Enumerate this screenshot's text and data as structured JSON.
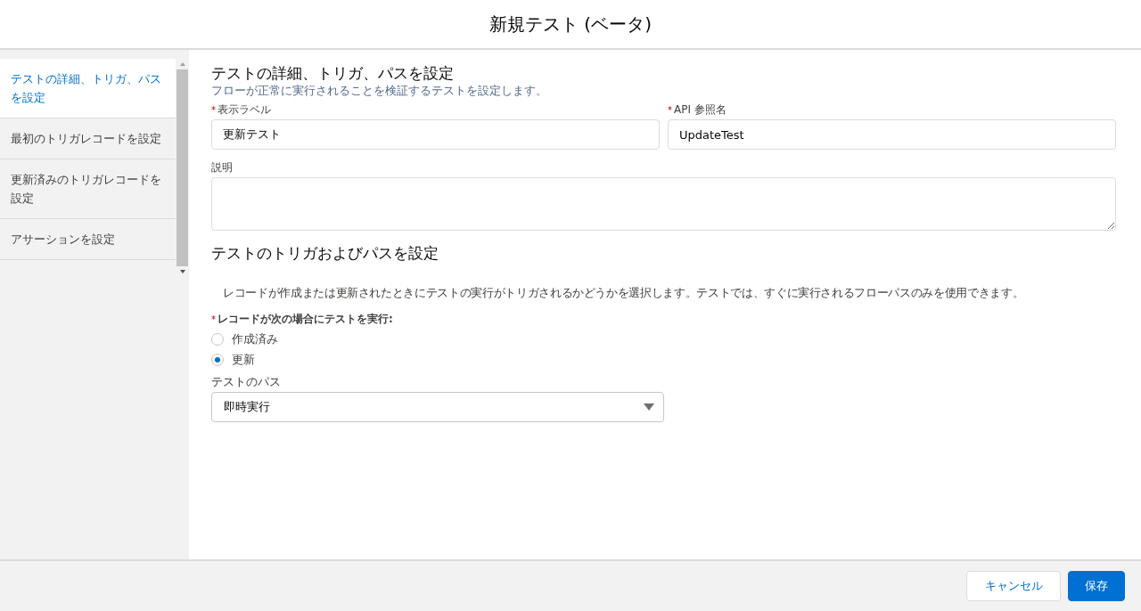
{
  "modal": {
    "title": "新規テスト (ベータ)"
  },
  "steps": [
    {
      "label": "テストの詳細、トリガ、パスを設定",
      "selected": true
    },
    {
      "label": "最初のトリガレコードを設定",
      "selected": false
    },
    {
      "label": "更新済みのトリガレコードを設定",
      "selected": false
    },
    {
      "label": "アサーションを設定",
      "selected": false
    }
  ],
  "details": {
    "heading": "テストの詳細、トリガ、パスを設定",
    "subtitle": "フローが正常に実行されることを検証するテストを設定します。",
    "fields": [
      {
        "label": "表示ラベル",
        "required": true,
        "value": "更新テスト"
      },
      {
        "label": "API 参照名",
        "required": true,
        "value": "UpdateTest"
      }
    ],
    "description": {
      "label": "説明"
    }
  },
  "trigger": {
    "heading": "テストのトリガおよびパスを設定",
    "help": "レコードが作成または更新されたときにテストの実行がトリガされるかどうかを選択します。テストでは、すぐに実行されるフローパスのみを使用できます。",
    "run_when": {
      "label": "レコードが次の場合にテストを実行:",
      "required": true,
      "options": [
        {
          "label": "作成済み",
          "selected": false
        },
        {
          "label": "更新",
          "selected": true
        }
      ]
    },
    "path": {
      "label": "テストのパス",
      "value": "即時実行"
    }
  },
  "buttons": [
    {
      "label": "キャンセル",
      "kind": "neutral"
    },
    {
      "label": "保存",
      "kind": "brand"
    }
  ]
}
